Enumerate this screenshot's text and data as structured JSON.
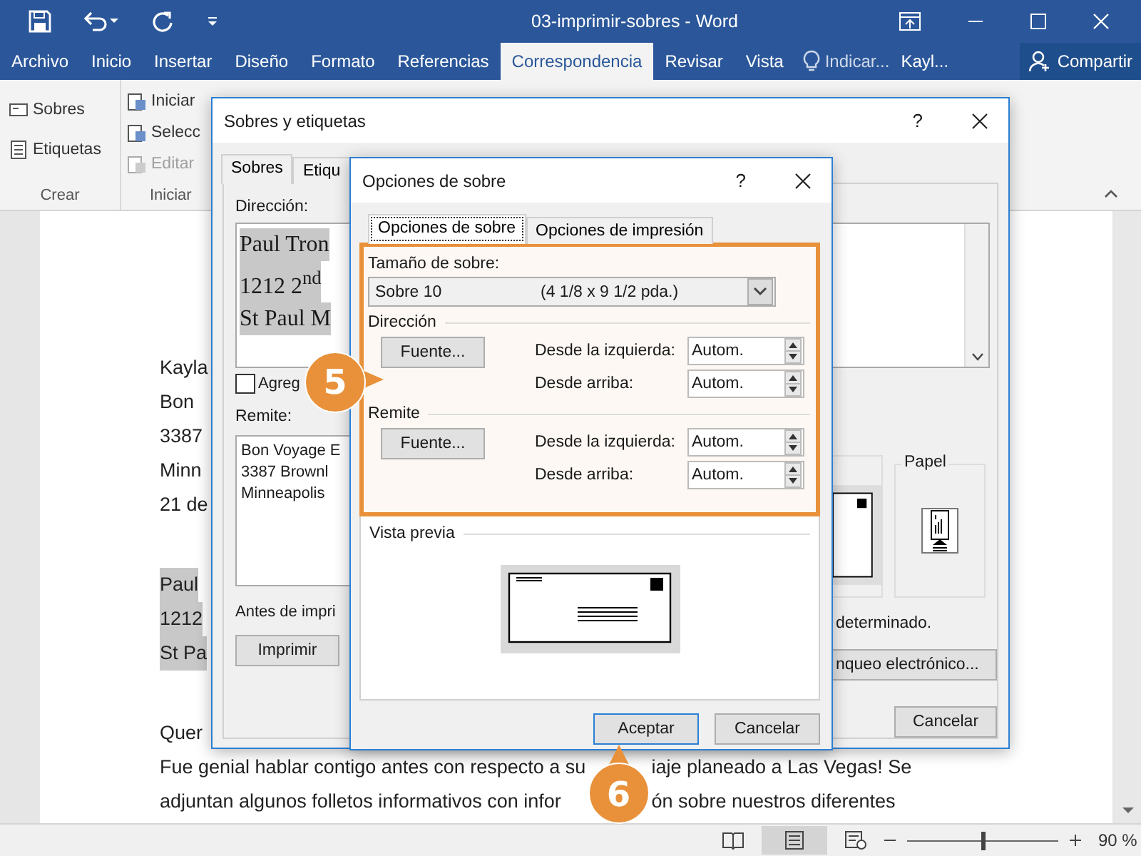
{
  "window": {
    "title": "03-imprimir-sobres - Word"
  },
  "ribbon_tabs": [
    {
      "label": "Archivo",
      "selected": false
    },
    {
      "label": "Inicio",
      "selected": false
    },
    {
      "label": "Insertar",
      "selected": false
    },
    {
      "label": "Diseño",
      "selected": false
    },
    {
      "label": "Formato",
      "selected": false
    },
    {
      "label": "Referencias",
      "selected": false
    },
    {
      "label": "Correspondencia",
      "selected": true
    },
    {
      "label": "Revisar",
      "selected": false
    },
    {
      "label": "Vista",
      "selected": false
    }
  ],
  "tell_me": "Indicar...",
  "user": "Kayl...",
  "share": "Compartir",
  "ribbon_groups": [
    {
      "label": "Crear",
      "items": [
        {
          "label": "Sobres",
          "disabled": false
        },
        {
          "label": "Etiquetas",
          "disabled": false
        }
      ]
    },
    {
      "label": "Iniciar",
      "items": [
        {
          "label": "Iniciar",
          "disabled": false
        },
        {
          "label": "Selecc",
          "disabled": false
        },
        {
          "label": "Editar",
          "disabled": true
        }
      ]
    }
  ],
  "document": {
    "address_lines": [
      "Kayla",
      "Bon",
      "3387",
      "Minn",
      "21 de"
    ],
    "highlighted_lines": [
      "Paul",
      "1212",
      "St Pa"
    ],
    "salutation": "Quer",
    "body_lines": [
      {
        "before": "Fue genial hablar contigo antes con respecto a su",
        "after": "iaje planeado a Las Vegas! Se"
      },
      {
        "before": "adjuntan algunos folletos informativos con infor",
        "after": "ón sobre nuestros diferentes"
      }
    ]
  },
  "envelopes_dialog": {
    "title": "Sobres y etiquetas",
    "help": "?",
    "tabs": [
      {
        "label": "Sobres",
        "selected": true
      },
      {
        "label": "Etiqu",
        "selected": false
      }
    ],
    "address_label": "Dirección:",
    "address_lines": [
      "Paul Tron",
      "1212 2$^{nd}$",
      "St Paul M"
    ],
    "add_postage": {
      "label": "Agreg",
      "checked": false
    },
    "return_label": "Remite:",
    "return_lines": [
      "Bon Voyage E",
      "3387 Brownl",
      "Minneapolis"
    ],
    "note_left": "Antes de impri",
    "note_right": "determinado.",
    "print_button": "Imprimir",
    "postage_button": "nqueo electrónico...",
    "feed_label": "Papel",
    "cancel_button": "Cancelar"
  },
  "options_dialog": {
    "title": "Opciones de sobre",
    "help": "?",
    "tabs": [
      {
        "label": "Opciones de sobre",
        "selected": true
      },
      {
        "label": "Opciones de impresión",
        "selected": false
      }
    ],
    "size_label": "Tamaño de sobre:",
    "size_value": "Sobre 10",
    "size_dims": "(4 1/8 x 9 1/2 pda.)",
    "sections": [
      {
        "title": "Dirección",
        "font_button": "Fuente...",
        "fields": [
          {
            "label": "Desde la izquierda:",
            "value": "Autom."
          },
          {
            "label": "Desde arriba:",
            "value": "Autom."
          }
        ]
      },
      {
        "title": "Remite",
        "font_button": "Fuente...",
        "fields": [
          {
            "label": "Desde la izquierda:",
            "value": "Autom."
          },
          {
            "label": "Desde arriba:",
            "value": "Autom."
          }
        ]
      }
    ],
    "preview_label": "Vista previa",
    "ok_button": "Aceptar",
    "cancel_button": "Cancelar"
  },
  "callouts": [
    {
      "number": "5",
      "kind": "right"
    },
    {
      "number": "6",
      "kind": "up"
    }
  ],
  "status_bar": {
    "zoom": {
      "level": 0.5,
      "reading": "90 %"
    }
  }
}
